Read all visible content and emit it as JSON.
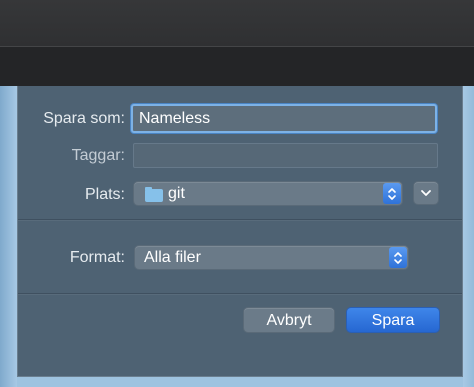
{
  "dialog": {
    "save_as_label": "Spara som:",
    "save_as_value": "Nameless",
    "tags_label": "Taggar:",
    "tags_value": "",
    "location_label": "Plats:",
    "location_value": "git",
    "format_label": "Format:",
    "format_value": "Alla filer",
    "cancel_label": "Avbryt",
    "save_label": "Spara"
  },
  "colors": {
    "accent": "#2f72d8",
    "sheet": "#4e6273",
    "focus_ring": "#7db2e6"
  },
  "icons": {
    "location": "folder-icon",
    "stepper": "up-down-chevron-icon",
    "expand": "chevron-down-icon"
  }
}
